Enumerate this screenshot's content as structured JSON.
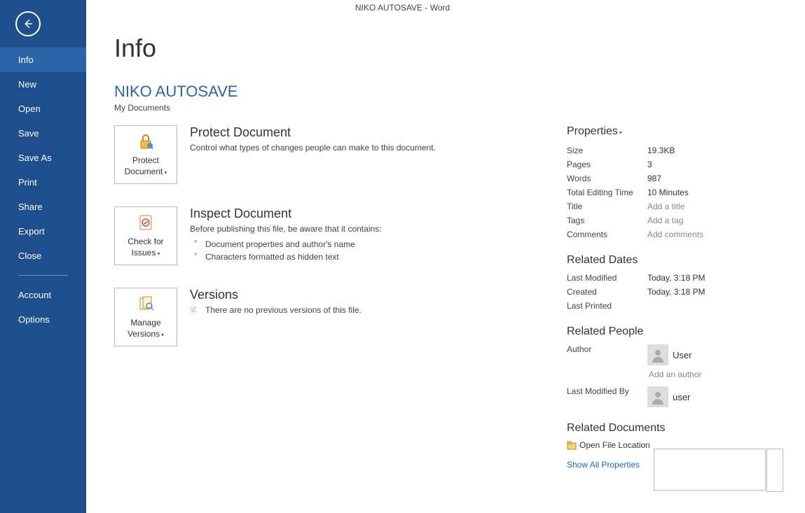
{
  "titlebar": "NIKO AUTOSAVE - Word",
  "nav": {
    "items": [
      "Info",
      "New",
      "Open",
      "Save",
      "Save As",
      "Print",
      "Share",
      "Export",
      "Close"
    ],
    "footer": [
      "Account",
      "Options"
    ],
    "active": "Info"
  },
  "page": {
    "title": "Info",
    "docName": "NIKO AUTOSAVE",
    "docPath": "My Documents"
  },
  "sections": {
    "protect": {
      "button": "Protect Document",
      "title": "Protect Document",
      "desc": "Control what types of changes people can make to this document."
    },
    "inspect": {
      "button": "Check for Issues",
      "title": "Inspect Document",
      "desc": "Before publishing this file, be aware that it contains:",
      "items": [
        "Document properties and author's name",
        "Characters formatted as hidden text"
      ]
    },
    "versions": {
      "button": "Manage Versions",
      "title": "Versions",
      "desc": "There are no previous versions of this file."
    }
  },
  "props": {
    "header": "Properties",
    "rows": [
      {
        "label": "Size",
        "value": "19.3KB"
      },
      {
        "label": "Pages",
        "value": "3"
      },
      {
        "label": "Words",
        "value": "987"
      },
      {
        "label": "Total Editing Time",
        "value": "10 Minutes"
      },
      {
        "label": "Title",
        "placeholder": "Add a title"
      },
      {
        "label": "Tags",
        "placeholder": "Add a tag"
      },
      {
        "label": "Comments",
        "placeholder": "Add comments"
      }
    ],
    "dates": {
      "header": "Related Dates",
      "rows": [
        {
          "label": "Last Modified",
          "value": "Today, 3:18 PM"
        },
        {
          "label": "Created",
          "value": "Today, 3:18 PM"
        },
        {
          "label": "Last Printed",
          "value": ""
        }
      ]
    },
    "people": {
      "header": "Related People",
      "author": {
        "label": "Author",
        "name": "User",
        "add": "Add an author"
      },
      "lastMod": {
        "label": "Last Modified By",
        "name": "user"
      }
    },
    "docs": {
      "header": "Related Documents",
      "open": "Open File Location"
    },
    "showAll": "Show All Properties"
  }
}
